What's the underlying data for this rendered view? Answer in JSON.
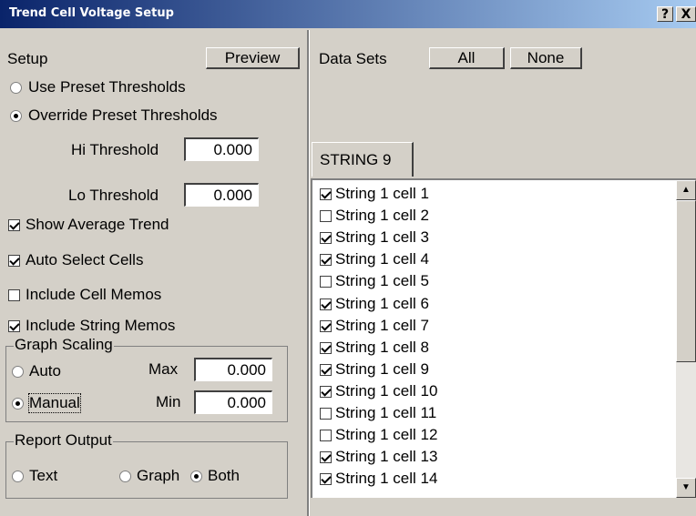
{
  "window": {
    "title": "Trend Cell Voltage Setup",
    "help_button": "?",
    "close_button": "X"
  },
  "setup": {
    "label": "Setup",
    "preview_button": "Preview",
    "use_preset": "Use Preset Thresholds",
    "override_preset": "Override Preset Thresholds",
    "selected_threshold_mode": "override",
    "hi_threshold_label": "Hi Threshold",
    "hi_threshold_value": "0.000",
    "lo_threshold_label": "Lo Threshold",
    "lo_threshold_value": "0.000",
    "show_average_trend": "Show Average Trend",
    "show_average_trend_checked": true,
    "auto_select_cells": "Auto Select Cells",
    "auto_select_cells_checked": true,
    "include_cell_memos": "Include Cell Memos",
    "include_cell_memos_checked": false,
    "include_string_memos": "Include String Memos",
    "include_string_memos_checked": true
  },
  "graph_scaling": {
    "label": "Graph Scaling",
    "auto": "Auto",
    "manual": "Manual",
    "selected": "manual",
    "max_label": "Max",
    "max_value": "0.000",
    "min_label": "Min",
    "min_value": "0.000"
  },
  "report_output": {
    "label": "Report Output",
    "text": "Text",
    "graph": "Graph",
    "both": "Both",
    "selected": "both"
  },
  "data_sets": {
    "label": "Data Sets",
    "all_button": "All",
    "none_button": "None",
    "tab": "STRING 9",
    "cells": [
      {
        "string": "String 1",
        "cell": "cell 1",
        "checked": true
      },
      {
        "string": "String 1",
        "cell": "cell 2",
        "checked": false
      },
      {
        "string": "String 1",
        "cell": "cell 3",
        "checked": true
      },
      {
        "string": "String 1",
        "cell": "cell 4",
        "checked": true
      },
      {
        "string": "String 1",
        "cell": "cell 5",
        "checked": false
      },
      {
        "string": "String 1",
        "cell": "cell 6",
        "checked": true
      },
      {
        "string": "String 1",
        "cell": "cell 7",
        "checked": true
      },
      {
        "string": "String 1",
        "cell": "cell 8",
        "checked": true
      },
      {
        "string": "String 1",
        "cell": "cell 9",
        "checked": true
      },
      {
        "string": "String 1",
        "cell": "cell 10",
        "checked": true
      },
      {
        "string": "String 1",
        "cell": "cell 11",
        "checked": false
      },
      {
        "string": "String 1",
        "cell": "cell 12",
        "checked": false
      },
      {
        "string": "String 1",
        "cell": "cell 13",
        "checked": true
      },
      {
        "string": "String 1",
        "cell": "cell 14",
        "checked": true
      }
    ]
  },
  "scrollbar": {
    "up_arrow": "▲",
    "down_arrow": "▼"
  },
  "colors": {
    "titlebar_start": "#0a246a",
    "titlebar_end": "#a6caf0",
    "dialog_face": "#d4d0c8"
  }
}
